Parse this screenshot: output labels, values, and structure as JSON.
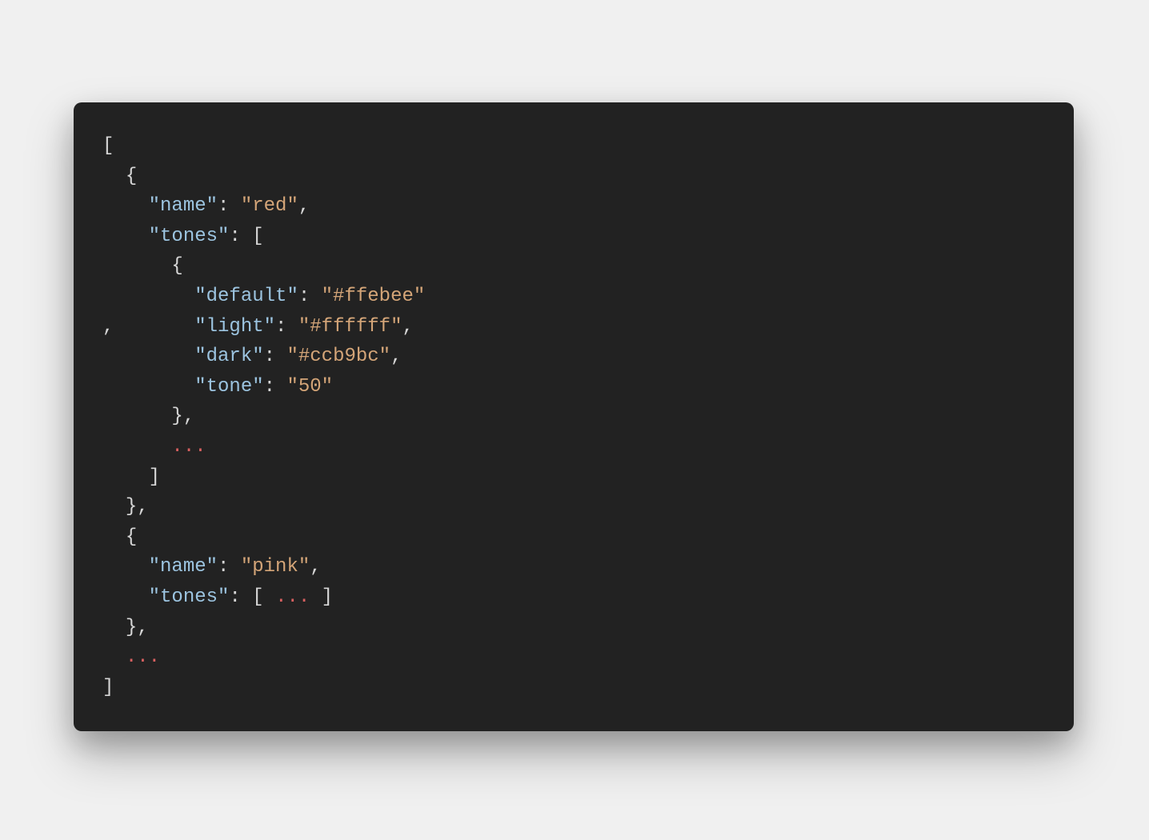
{
  "code": {
    "line1": "[",
    "line2_indent": "  ",
    "line2_brace": "{",
    "line3_indent": "    ",
    "line3_key": "\"name\"",
    "line3_colon": ": ",
    "line3_val": "\"red\"",
    "line3_comma": ",",
    "line4_indent": "    ",
    "line4_key": "\"tones\"",
    "line4_colon": ": ",
    "line4_bracket": "[",
    "line5_indent": "      ",
    "line5_brace": "{",
    "line6_indent": "        ",
    "line6_key": "\"default\"",
    "line6_colon": ": ",
    "line6_val": "\"#ffebee\"",
    "line7_comma": ",       ",
    "line7_key": "\"light\"",
    "line7_colon": ": ",
    "line7_val": "\"#ffffff\"",
    "line7_trailcomma": ",",
    "line8_indent": "        ",
    "line8_key": "\"dark\"",
    "line8_colon": ": ",
    "line8_val": "\"#ccb9bc\"",
    "line8_comma": ",",
    "line9_indent": "        ",
    "line9_key": "\"tone\"",
    "line9_colon": ": ",
    "line9_val": "\"50\"",
    "line10_indent": "      ",
    "line10_brace": "},",
    "line11_indent": "      ",
    "line11_ellipsis": "...",
    "line12_indent": "    ",
    "line12_bracket": "]",
    "line13_indent": "  ",
    "line13_brace": "},",
    "line14_indent": "  ",
    "line14_brace": "{",
    "line15_indent": "    ",
    "line15_key": "\"name\"",
    "line15_colon": ": ",
    "line15_val": "\"pink\"",
    "line15_comma": ",",
    "line16_indent": "    ",
    "line16_key": "\"tones\"",
    "line16_colon": ": ",
    "line16_open": "[ ",
    "line16_ellipsis": "...",
    "line16_close": " ]",
    "line17_indent": "  ",
    "line17_brace": "},",
    "line18_indent": "  ",
    "line18_ellipsis": "...",
    "line19": "]"
  }
}
